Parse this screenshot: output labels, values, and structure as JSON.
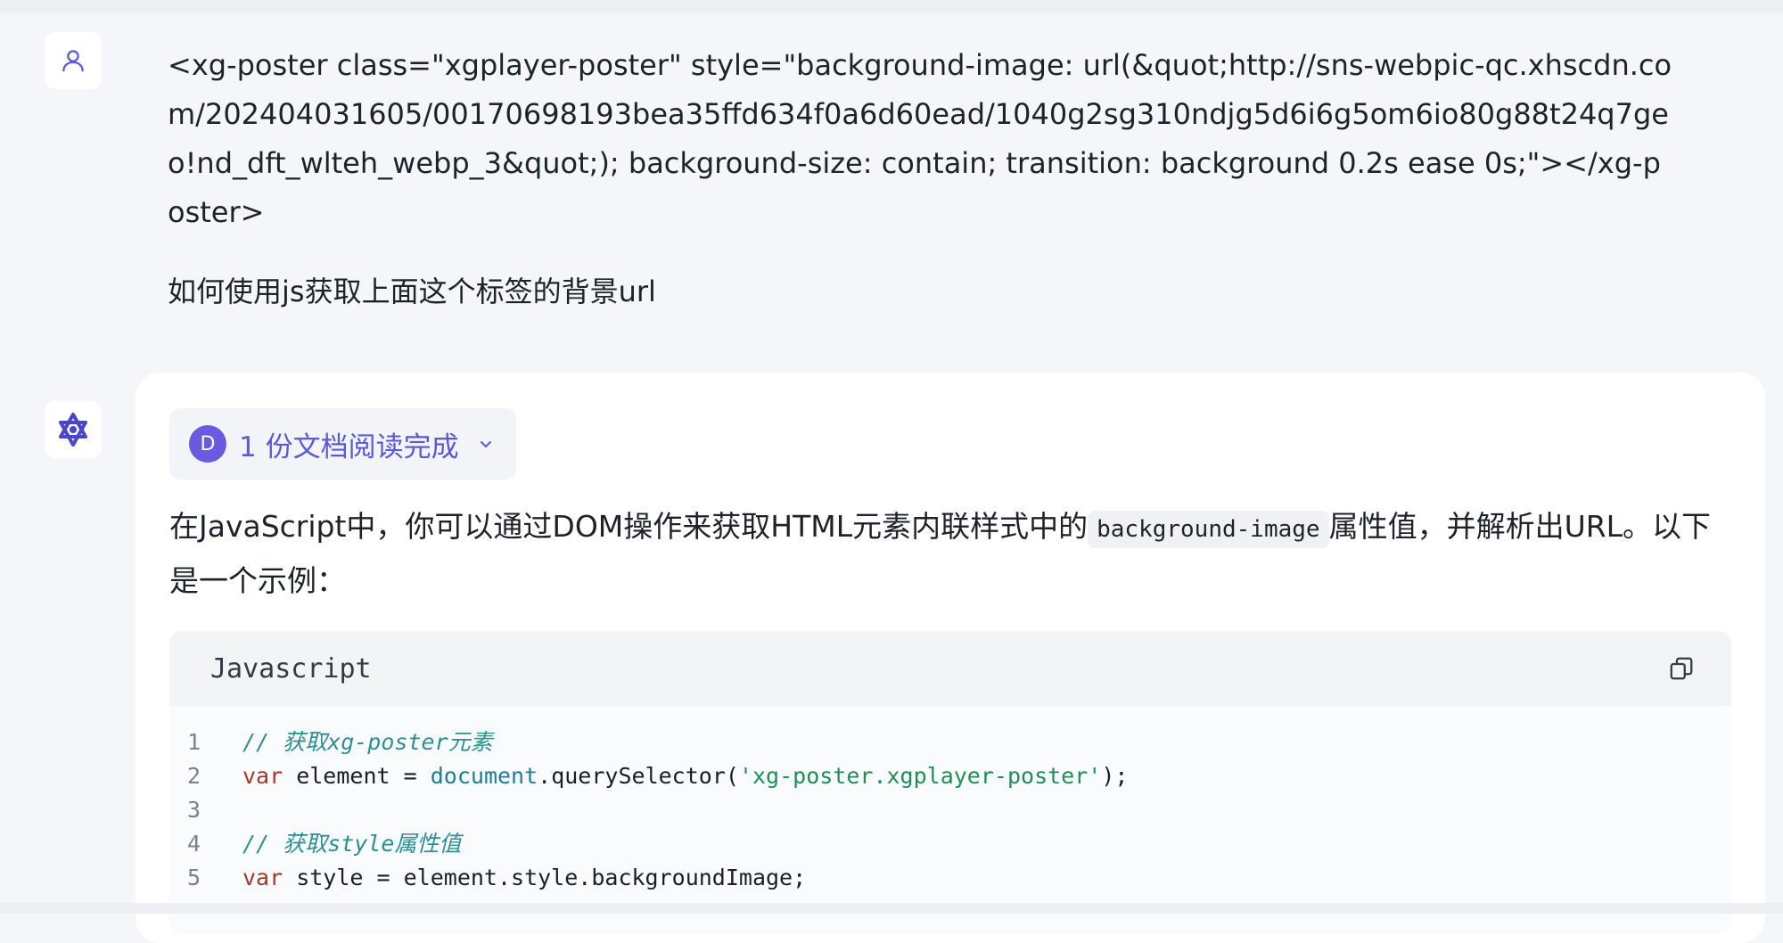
{
  "user": {
    "avatar_icon": "user-icon",
    "message": "<xg-poster class=\"xgplayer-poster\" style=\"background-image: url(&quot;http://sns-webpic-qc.xhscdn.com/202404031605/00170698193bea35ffd634f0a6d60ead/1040g2sg310ndjg5d6i6g5om6io80g88t24q7geo!nd_dft_wlteh_webp_3&quot;); background-size: contain; transition: background 0.2s ease 0s;\"></xg-poster>",
    "question": "如何使用js获取上面这个标签的背景url"
  },
  "assistant": {
    "avatar_icon": "bot-logo-icon",
    "doc_status": {
      "badge_letter": "D",
      "label": "1 份文档阅读完成",
      "chevron_icon": "chevron-down-icon"
    },
    "answer_part1": "在JavaScript中，你可以通过DOM操作来获取HTML元素内联样式中的",
    "inline_code": "background-image",
    "answer_part2": "属性值，并解析出URL。以下是一个示例：",
    "code_block": {
      "language": "Javascript",
      "copy_icon": "copy-icon",
      "lines": [
        {
          "no": "1",
          "comment": "// 获取xg-poster元素"
        },
        {
          "no": "2",
          "kw": "var",
          "name": " element = ",
          "glob": "document",
          "rest": ".querySelector(",
          "str": "'xg-poster.xgplayer-poster'",
          "end": ");"
        },
        {
          "no": "3"
        },
        {
          "no": "4",
          "comment": "// 获取style属性值"
        },
        {
          "no": "5",
          "kw": "var",
          "name": " style = element.style.backgroundImage;"
        }
      ]
    }
  },
  "colors": {
    "accent": "#5a59d6",
    "badge": "#6a5ae0",
    "page_bg": "#f4f6fa"
  }
}
